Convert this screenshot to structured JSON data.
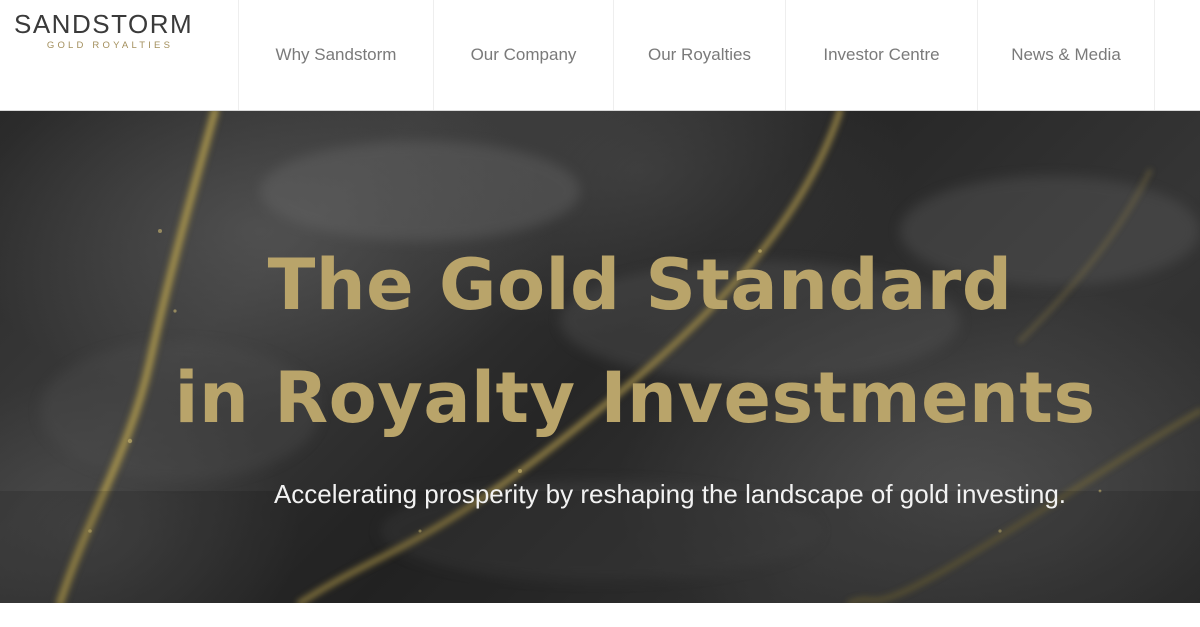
{
  "brand": {
    "name": "SANDSTORM",
    "tagline": "GOLD ROYALTIES"
  },
  "nav": {
    "items": [
      {
        "label": "Why Sandstorm"
      },
      {
        "label": "Our Company"
      },
      {
        "label": "Our Royalties"
      },
      {
        "label": "Investor Centre"
      },
      {
        "label": "News & Media"
      }
    ]
  },
  "hero": {
    "title_line1": "The Gold Standard",
    "title_line2": "in Royalty Investments",
    "subtitle": "Accelerating prosperity by reshaping the landscape of gold investing."
  },
  "colors": {
    "gold": "#b9a46a",
    "logo_gold": "#a38f5c",
    "nav_text": "#7a7a7a",
    "stone_dark": "#2a2a2a"
  }
}
